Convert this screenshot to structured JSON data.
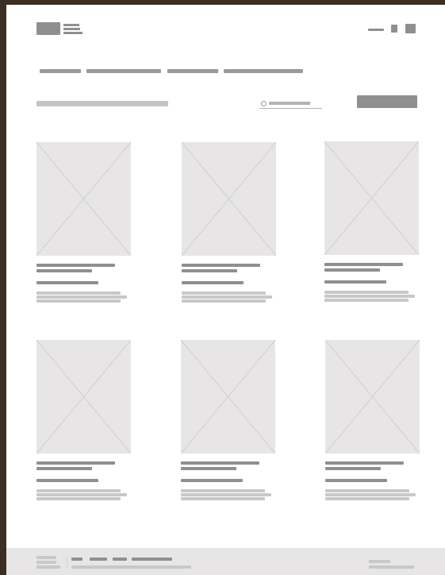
{
  "app": {
    "name": "",
    "title": ""
  },
  "header": {
    "logo": {
      "icon": "logo-placeholder-icon"
    },
    "actions": [
      {
        "name": "menu-link"
      },
      {
        "name": "profile-icon"
      },
      {
        "name": "cart-icon"
      }
    ]
  },
  "navigation": {
    "items": [
      {
        "label": ""
      },
      {
        "label": ""
      },
      {
        "label": ""
      },
      {
        "label": ""
      }
    ]
  },
  "toolbar": {
    "page_title": "",
    "search": {
      "placeholder": ""
    },
    "primary_button": {
      "label": ""
    }
  },
  "products": [
    {
      "title": "",
      "subtitle": "",
      "price": "",
      "description": ""
    },
    {
      "title": "",
      "subtitle": "",
      "price": "",
      "description": ""
    },
    {
      "title": "",
      "subtitle": "",
      "price": "",
      "description": ""
    },
    {
      "title": "",
      "subtitle": "",
      "price": "",
      "description": ""
    },
    {
      "title": "",
      "subtitle": "",
      "price": "",
      "description": ""
    },
    {
      "title": "",
      "subtitle": "",
      "price": "",
      "description": ""
    }
  ],
  "footer": {
    "links": [
      {
        "label": ""
      },
      {
        "label": ""
      },
      {
        "label": ""
      },
      {
        "label": ""
      }
    ],
    "copyright": "",
    "contact": ""
  },
  "colors": {
    "frame": "#3a2f22",
    "page": "#ffffff",
    "placeholder_fill": "#e7e5e5",
    "dark_line": "#8f8f8f",
    "light_line": "#c8c8c8"
  }
}
